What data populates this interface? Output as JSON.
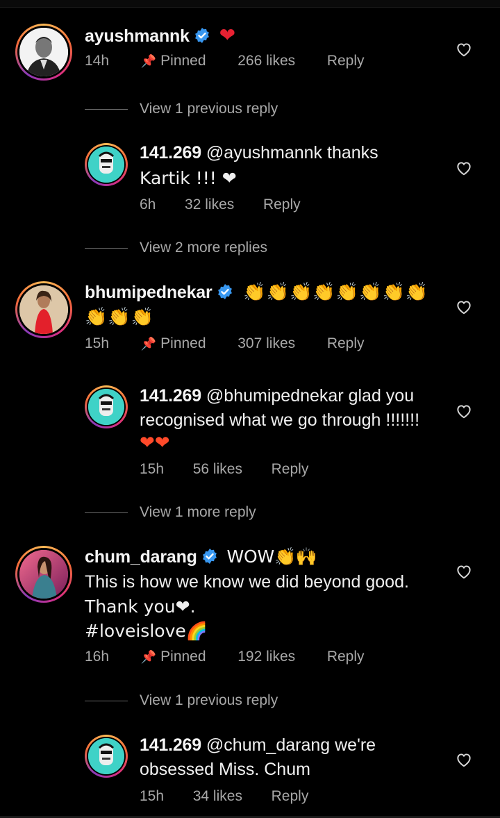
{
  "comments": [
    {
      "username": "ayushmannk",
      "text_after": "❤",
      "time": "14h",
      "pinned": "Pinned",
      "likes": "266 likes",
      "reply": "Reply",
      "view_replies": "View 1 previous reply"
    },
    {
      "username": "bhumipednekar",
      "text_after": "👏👏👏👏👏👏👏👏",
      "text_line2": "👏👏👏",
      "time": "15h",
      "pinned": "Pinned",
      "likes": "307 likes",
      "reply": "Reply"
    },
    {
      "username": "chum_darang",
      "text_after": "WOW👏🙌",
      "text_line2": "This is how we know we did beyond good.",
      "text_line3": "Thank you❤.",
      "text_line4": "#loveislove🌈",
      "time": "16h",
      "pinned": "Pinned",
      "likes": "192 likes",
      "reply": "Reply",
      "view_replies": "View 1 previous reply"
    }
  ],
  "replies": [
    {
      "username": "141.269",
      "line1": "@ayushmannk thanks",
      "line2": "Kartik !!! ❤",
      "time": "6h",
      "likes": "32 likes",
      "reply": "Reply",
      "view_more": "View 2 more replies"
    },
    {
      "username": "141.269",
      "line1": "@bhumipednekar glad you",
      "line2": "recognised what we go through !!!!!!!",
      "line3": "❤❤",
      "time": "15h",
      "likes": "56 likes",
      "reply": "Reply",
      "view_more": "View 1 more reply"
    },
    {
      "username": "141.269",
      "line1": "@chum_darang we're",
      "line2": "obsessed Miss. Chum",
      "time": "15h",
      "likes": "34 likes",
      "reply": "Reply"
    }
  ],
  "colors": {
    "background": "#000000",
    "verified": "#3897f0",
    "muted": "#a8a8a8"
  }
}
